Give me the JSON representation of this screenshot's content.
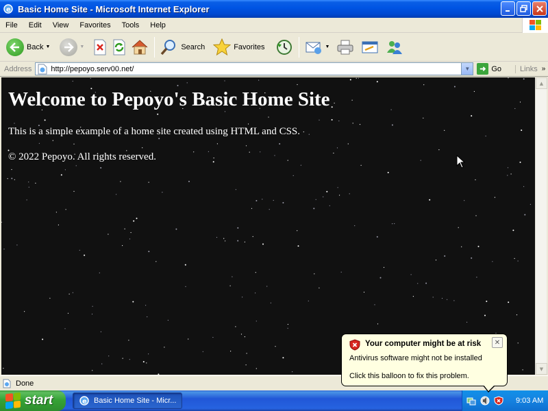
{
  "window": {
    "title": "Basic Home Site - Microsoft Internet Explorer"
  },
  "menu": [
    "File",
    "Edit",
    "View",
    "Favorites",
    "Tools",
    "Help"
  ],
  "toolbar": {
    "back_label": "Back",
    "search_label": "Search",
    "favorites_label": "Favorites"
  },
  "address": {
    "label": "Address",
    "url": "http://pepoyo.serv00.net/",
    "go_label": "Go",
    "links_label": "Links"
  },
  "page": {
    "heading": "Welcome to Pepoyo's Basic Home Site",
    "intro": "This is a simple example of a home site created using HTML and CSS.",
    "footer": "© 2022 Pepoyo. All rights reserved."
  },
  "status": {
    "text": "Done"
  },
  "taskbar": {
    "start_label": "start",
    "task_label": "Basic Home Site - Micr...",
    "clock": "9:03 AM"
  },
  "balloon": {
    "title": "Your computer might be at risk",
    "line1": "Antivirus software might not be installed",
    "line2": "Click this balloon to fix this problem."
  },
  "colors": {
    "titlebar": "#0054E3",
    "page_background": "#111111",
    "taskbar": "#245EDC",
    "start_button": "#36A336",
    "balloon_background": "#FFFFE1"
  },
  "icons": [
    "ie-icon",
    "back-icon",
    "forward-icon",
    "stop-icon",
    "refresh-icon",
    "home-icon",
    "search-icon",
    "favorites-star-icon",
    "history-icon",
    "mail-icon",
    "print-icon",
    "edit-icon",
    "messenger-icon",
    "windows-logo-icon",
    "security-shield-icon"
  ]
}
